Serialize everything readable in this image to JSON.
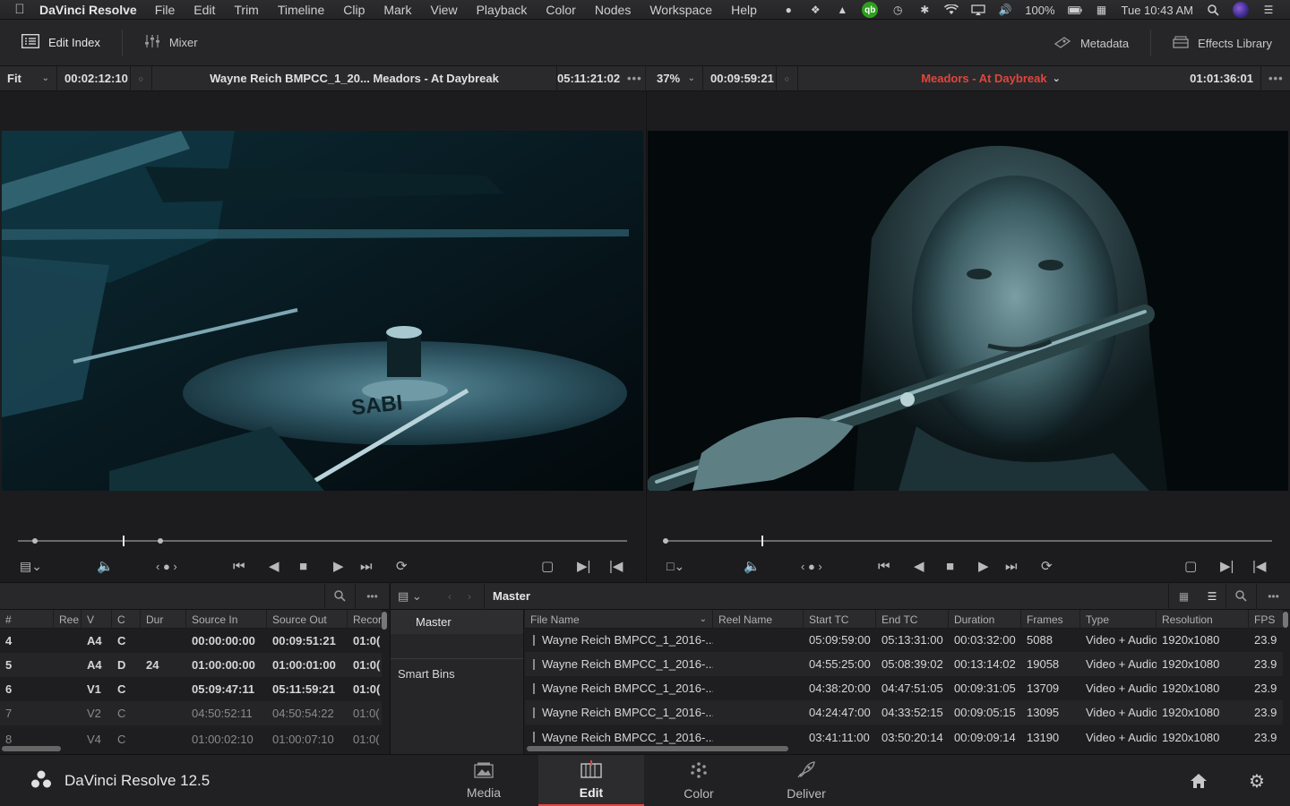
{
  "menubar": {
    "app_name": "DaVinci Resolve",
    "menus": [
      "File",
      "Edit",
      "Trim",
      "Timeline",
      "Clip",
      "Mark",
      "View",
      "Playback",
      "Color",
      "Nodes",
      "Workspace",
      "Help"
    ],
    "battery": "100%",
    "clock": "Tue 10:43 AM",
    "quickbooks_label": "qb"
  },
  "toolbar": {
    "edit_index": "Edit Index",
    "mixer": "Mixer",
    "metadata": "Metadata",
    "effects_library": "Effects Library"
  },
  "source_viewer": {
    "zoom": "Fit",
    "timecode_left": "00:02:12:10",
    "title": "Wayne Reich BMPCC_1_20... Meadors - At Daybreak",
    "timecode_right": "05:11:21:02"
  },
  "timeline_viewer": {
    "zoom": "37%",
    "timecode_left": "00:09:59:21",
    "timeline_name": "Meadors - At Daybreak",
    "timecode_right": "01:01:36:01"
  },
  "edit_index": {
    "columns": [
      "#",
      "Ree",
      "V",
      "C",
      "Dur",
      "Source In",
      "Source Out",
      "Recor"
    ],
    "rows": [
      {
        "num": "4",
        "reel": "",
        "v": "A4",
        "c": "C",
        "dur": "",
        "src_in": "00:00:00:00",
        "src_out": "00:09:51:21",
        "rec": "01:0("
      },
      {
        "num": "5",
        "reel": "",
        "v": "A4",
        "c": "D",
        "dur": "24",
        "src_in": "01:00:00:00",
        "src_out": "01:00:01:00",
        "rec": "01:0("
      },
      {
        "num": "6",
        "reel": "",
        "v": "V1",
        "c": "C",
        "dur": "",
        "src_in": "05:09:47:11",
        "src_out": "05:11:59:21",
        "rec": "01:0("
      },
      {
        "num": "7",
        "reel": "",
        "v": "V2",
        "c": "C",
        "dur": "",
        "src_in": "04:50:52:11",
        "src_out": "04:50:54:22",
        "rec": "01:0("
      },
      {
        "num": "8",
        "reel": "",
        "v": "V4",
        "c": "C",
        "dur": "",
        "src_in": "01:00:02:10",
        "src_out": "01:00:07:10",
        "rec": "01:0("
      }
    ]
  },
  "media_pool": {
    "current_bin": "Master",
    "bins": [
      "Master"
    ],
    "smart_bins": "Smart Bins",
    "columns": [
      "File Name",
      "Reel Name",
      "Start TC",
      "End TC",
      "Duration",
      "Frames",
      "Type",
      "Resolution",
      "FPS"
    ],
    "clips": [
      {
        "name": "Wayne Reich BMPCC_1_2016-...",
        "reel": "",
        "start": "05:09:59:00",
        "end": "05:13:31:00",
        "duration": "00:03:32:00",
        "frames": "5088",
        "type": "Video + Audio",
        "res": "1920x1080",
        "fps": "23.9"
      },
      {
        "name": "Wayne Reich BMPCC_1_2016-...",
        "reel": "",
        "start": "04:55:25:00",
        "end": "05:08:39:02",
        "duration": "00:13:14:02",
        "frames": "19058",
        "type": "Video + Audio",
        "res": "1920x1080",
        "fps": "23.9"
      },
      {
        "name": "Wayne Reich BMPCC_1_2016-...",
        "reel": "",
        "start": "04:38:20:00",
        "end": "04:47:51:05",
        "duration": "00:09:31:05",
        "frames": "13709",
        "type": "Video + Audio",
        "res": "1920x1080",
        "fps": "23.9"
      },
      {
        "name": "Wayne Reich BMPCC_1_2016-...",
        "reel": "",
        "start": "04:24:47:00",
        "end": "04:33:52:15",
        "duration": "00:09:05:15",
        "frames": "13095",
        "type": "Video + Audio",
        "res": "1920x1080",
        "fps": "23.9"
      },
      {
        "name": "Wayne Reich BMPCC_1_2016-...",
        "reel": "",
        "start": "03:41:11:00",
        "end": "03:50:20:14",
        "duration": "00:09:09:14",
        "frames": "13190",
        "type": "Video + Audio",
        "res": "1920x1080",
        "fps": "23.9"
      }
    ]
  },
  "pagebar": {
    "product": "DaVinci Resolve 12.5",
    "pages": [
      "Media",
      "Edit",
      "Color",
      "Deliver"
    ],
    "active_page": "Edit"
  },
  "colors": {
    "accent_red": "#e2453c",
    "background": "#1e1e20"
  }
}
